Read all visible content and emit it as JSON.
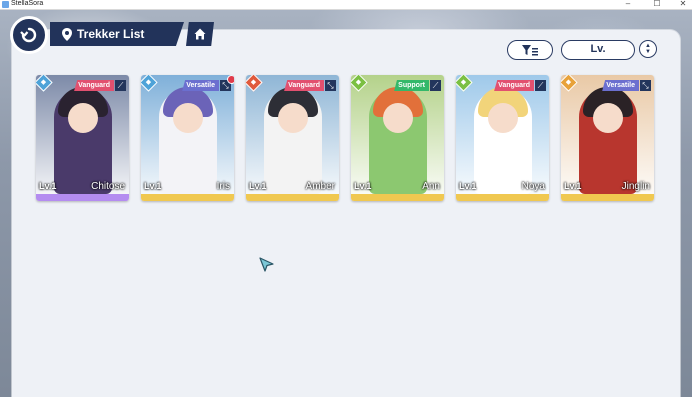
{
  "window": {
    "title": "StellaSora",
    "minimize": "–",
    "maximize": "☐",
    "close": "✕"
  },
  "header": {
    "title": "Trekker List",
    "back_icon": "back-arrow-icon",
    "location_icon": "map-pin-icon",
    "home_icon": "home-icon"
  },
  "toolbar": {
    "filter_icon": "filter-icon",
    "sort_label": "Lv.",
    "order_icon": "sort-order-icon"
  },
  "colors": {
    "navy": "#22335a",
    "panel": "#eef1f6",
    "vanguard": "#e2506f",
    "versatile": "#6b6fcf",
    "support": "#33b86a"
  },
  "trekkers": [
    {
      "name": "Chitose",
      "level": "Lv.1",
      "role": "Vanguard",
      "role_color": "#e2506f",
      "element_color": "#4ea3d8",
      "weapon": "⟋",
      "rarity": "#b48cf0",
      "hair": "#2a2230",
      "outfit": "#4a3a6a",
      "bg": "#7c8aa8",
      "new": false
    },
    {
      "name": "Iris",
      "level": "Lv.1",
      "role": "Versatile",
      "role_color": "#6b6fcf",
      "element_color": "#4ea3d8",
      "weapon": "⤡",
      "rarity": "#f0c850",
      "hair": "#6b63b8",
      "outfit": "#f3f3f7",
      "bg": "#7fb0d9",
      "new": true
    },
    {
      "name": "Amber",
      "level": "Lv.1",
      "role": "Vanguard",
      "role_color": "#e2506f",
      "element_color": "#e05a3c",
      "weapon": "⤡",
      "rarity": "#f0c850",
      "hair": "#2d2e36",
      "outfit": "#f3f3f3",
      "bg": "#8fb6d6",
      "new": false
    },
    {
      "name": "Ann",
      "level": "Lv.1",
      "role": "Support",
      "role_color": "#33b86a",
      "element_color": "#7bc043",
      "weapon": "⟋",
      "rarity": "#f0c850",
      "hair": "#e2703a",
      "outfit": "#8cc870",
      "bg": "#b4d28a",
      "new": false
    },
    {
      "name": "Noya",
      "level": "Lv.1",
      "role": "Vanguard",
      "role_color": "#e2506f",
      "element_color": "#7bc043",
      "weapon": "⟋",
      "rarity": "#f0c850",
      "hair": "#f2d47a",
      "outfit": "#ffffff",
      "bg": "#9fc9ea",
      "new": false
    },
    {
      "name": "Jinglin",
      "level": "Lv.1",
      "role": "Versatile",
      "role_color": "#6b6fcf",
      "element_color": "#e8a23a",
      "weapon": "⤡",
      "rarity": "#f0c850",
      "hair": "#2a2226",
      "outfit": "#b8362e",
      "bg": "#e9c9a6",
      "new": false
    }
  ]
}
